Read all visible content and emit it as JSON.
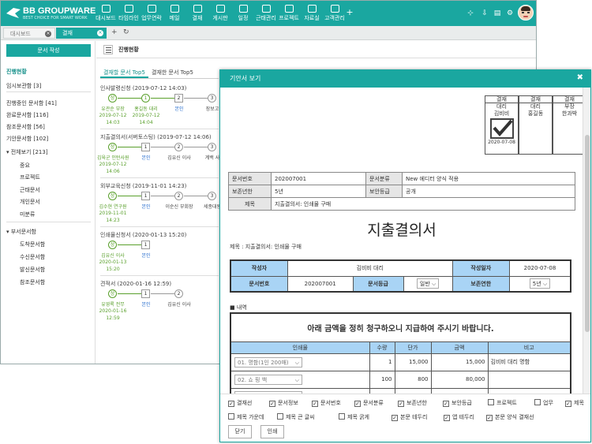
{
  "app": {
    "logo_title": "BB GROUPWARE",
    "logo_sub": "BEST CHOICE FOR SMART WORK"
  },
  "nav": [
    {
      "label": "대시보드",
      "icon": "monitor-icon"
    },
    {
      "label": "타임라인",
      "icon": "timeline-icon"
    },
    {
      "label": "업무연락",
      "icon": "chat-icon"
    },
    {
      "label": "메일",
      "icon": "mail-icon"
    },
    {
      "label": "결재",
      "icon": "check-icon"
    },
    {
      "label": "게시판",
      "icon": "board-icon"
    },
    {
      "label": "일정",
      "icon": "calendar-icon"
    },
    {
      "label": "근태관리",
      "icon": "attendance-icon"
    },
    {
      "label": "프로젝트",
      "icon": "project-icon"
    },
    {
      "label": "자료실",
      "icon": "database-icon"
    },
    {
      "label": "고객관리",
      "icon": "customer-icon"
    }
  ],
  "nav_plus": "+",
  "window_tabs": [
    "대시보드",
    "결재"
  ],
  "sidebar": {
    "write_button": "문서 작성",
    "items": [
      "진행현황",
      "임시보관함 [3]",
      "진행중인 문서함 [41]",
      "완료문서함 [116]",
      "참조문서함 [56]",
      "기안문서함 [102]",
      "▾ 전체보기 [213]",
      "중요",
      "프로젝트",
      "근태문서",
      "개인문서",
      "미분류",
      "▾ 부서문서함",
      "도착문서함",
      "수신문서함",
      "발신문서함",
      "참조문서함"
    ]
  },
  "main": {
    "breadcrumb": "진행현황",
    "tabs": [
      "결재할 문서 Top5",
      "결재한 문서 Top5"
    ],
    "docs": [
      {
        "title": "인사발령신청 (2019-07-12 14:03)",
        "steps": [
          {
            "mark": "상",
            "name": "유관순 부장",
            "date1": "2019-07-12",
            "date2": "14:03",
            "state": "ok"
          },
          {
            "mark": "1",
            "name": "홍길동 대리",
            "date1": "2019-07-12",
            "date2": "14:04",
            "state": "ok"
          },
          {
            "mark": "2",
            "name": "본인",
            "date1": "",
            "date2": "",
            "state": "cur"
          },
          {
            "mark": "3",
            "name": "장보고",
            "date1": "",
            "date2": "",
            "state": "todo"
          }
        ]
      },
      {
        "title": "지출결의서(서버토스팅) (2019-07-12 14:06)",
        "steps": [
          {
            "mark": "상",
            "name": "김육군 인턴사원",
            "date1": "2019-07-12",
            "date2": "14:06",
            "state": "ok"
          },
          {
            "mark": "1",
            "name": "본인",
            "date1": "",
            "date2": "",
            "state": "cur"
          },
          {
            "mark": "2",
            "name": "김유신 이사",
            "date1": "",
            "date2": "",
            "state": "todo"
          },
          {
            "mark": "3",
            "name": "계백 사",
            "date1": "",
            "date2": "",
            "state": "todo"
          }
        ]
      },
      {
        "title": "외부교육신청 (2019-11-01 14:23)",
        "steps": [
          {
            "mark": "상",
            "name": "김수현 연구원",
            "date1": "2019-11-01",
            "date2": "14:23",
            "state": "ok"
          },
          {
            "mark": "1",
            "name": "본인",
            "date1": "",
            "date2": "",
            "state": "cur"
          },
          {
            "mark": "2",
            "name": "이순신 부회장",
            "date1": "",
            "date2": "",
            "state": "todo"
          },
          {
            "mark": "3",
            "name": "세종대왕",
            "date1": "",
            "date2": "",
            "state": "todo"
          }
        ]
      },
      {
        "title": "인쇄물신청서 (2020-01-13 15:20)",
        "steps": [
          {
            "mark": "상",
            "name": "김유신 이사",
            "date1": "2020-01-13",
            "date2": "15:20",
            "state": "ok"
          },
          {
            "mark": "1",
            "name": "본인",
            "date1": "",
            "date2": "",
            "state": "cur"
          }
        ]
      },
      {
        "title": "견적서 (2020-01-16 12:59)",
        "steps": [
          {
            "mark": "상",
            "name": "유영록 전무",
            "date1": "2020-01-16",
            "date2": "12:59",
            "state": "ok"
          },
          {
            "mark": "1",
            "name": "본인",
            "date1": "",
            "date2": "",
            "state": "cur"
          },
          {
            "mark": "2",
            "name": "김유신 이사",
            "date1": "",
            "date2": "",
            "state": "todo"
          }
        ]
      }
    ]
  },
  "dialog": {
    "title": "기안서 보기",
    "close": "✖",
    "approvals": [
      {
        "head": "결재",
        "role": "대리",
        "name": "김비비",
        "date": "2020-07-08",
        "signed": true
      },
      {
        "head": "결재",
        "role": "대리",
        "name": "홍길동",
        "date": "",
        "signed": false
      },
      {
        "head": "결재",
        "role": "부장",
        "name": "한과박",
        "date": "",
        "signed": false
      }
    ],
    "info": {
      "doc_no_label": "문서번호",
      "doc_no": "202007001",
      "category_label": "문서분류",
      "category": "New 에디터 양식 적용",
      "retention_label": "보존년한",
      "retention": "5년",
      "security_label": "보안등급",
      "security": "공개",
      "subject_label": "제목",
      "subject": "지출결의서: 인쇄물 구매"
    },
    "doc_title": "지출결의서",
    "subject_line": "제목 : 지출결의서: 인쇄물 구매",
    "form": {
      "writer_label": "작성자",
      "writer": "김비비 대리",
      "date_label": "작성일자",
      "date": "2020-07-08",
      "docno_label": "문서번호",
      "docno": "202007001",
      "grade_label": "문서등급",
      "grade": "일반",
      "keep_label": "보존연한",
      "keep": "5년"
    },
    "section": "■ 내역",
    "items_intro": "아래 금액을 정히 청구하오니 지급하여 주시기 바랍니다.",
    "items_headers": [
      "인쇄물",
      "수량",
      "단가",
      "금액",
      "비고"
    ],
    "items": [
      {
        "name": "01. 명함(1인 200매)",
        "qty": "1",
        "price": "15,000",
        "amount": "15,000",
        "note": "김비비 대리 명함"
      },
      {
        "name": "02. 쇼 핑 백",
        "qty": "100",
        "price": "800",
        "amount": "80,000",
        "note": ""
      },
      {
        "name": "04. 소 봉 투",
        "qty": "500",
        "price": "80",
        "amount": "40,000",
        "note": ""
      }
    ],
    "options": [
      {
        "label": "결재선",
        "checked": true
      },
      {
        "label": "문서정보",
        "checked": true
      },
      {
        "label": "문서번호",
        "checked": true
      },
      {
        "label": "문서분류",
        "checked": true
      },
      {
        "label": "보존년한",
        "checked": true
      },
      {
        "label": "보안등급",
        "checked": true
      },
      {
        "label": "프로젝트",
        "checked": false
      },
      {
        "label": "업무",
        "checked": false
      },
      {
        "label": "제목",
        "checked": true
      },
      {
        "label": "제목 가운데",
        "checked": false
      },
      {
        "label": "제목 큰 글씨",
        "checked": false
      },
      {
        "label": "제목 굵게",
        "checked": false
      },
      {
        "label": "본문 테두리",
        "checked": true
      },
      {
        "label": "앱 테두리",
        "checked": true
      },
      {
        "label": "본문 양식 결재선",
        "checked": true
      }
    ],
    "btn_close": "닫기",
    "btn_print": "인쇄"
  },
  "colors": {
    "accent": "#1aa7a0",
    "header_cell": "#a9d4f5",
    "ok_green": "#5aa02c",
    "link_blue": "#2a6fcf"
  }
}
